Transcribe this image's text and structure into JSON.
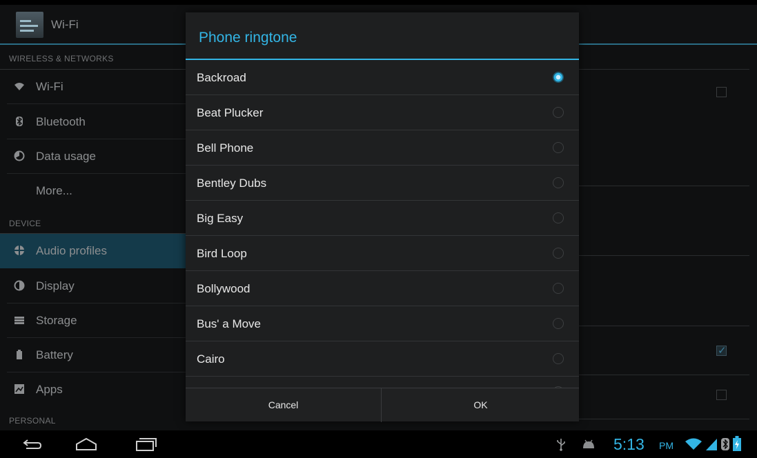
{
  "actionbar": {
    "title": "Wi-Fi"
  },
  "sidebar": {
    "sections": [
      {
        "header": "WIRELESS & NETWORKS"
      },
      {
        "header": "DEVICE"
      },
      {
        "header": "PERSONAL"
      }
    ],
    "items": [
      {
        "label": "Wi-Fi",
        "icon": "wifi-icon"
      },
      {
        "label": "Bluetooth",
        "icon": "bluetooth-icon"
      },
      {
        "label": "Data usage",
        "icon": "data-usage-icon"
      },
      {
        "label": "More...",
        "icon": ""
      },
      {
        "label": "Audio profiles",
        "icon": "audio-profiles-icon",
        "active": true
      },
      {
        "label": "Display",
        "icon": "display-icon"
      },
      {
        "label": "Storage",
        "icon": "storage-icon"
      },
      {
        "label": "Battery",
        "icon": "battery-icon"
      },
      {
        "label": "Apps",
        "icon": "apps-icon"
      }
    ]
  },
  "dialog": {
    "title": "Phone ringtone",
    "options": [
      {
        "label": "Backroad",
        "checked": true
      },
      {
        "label": "Beat Plucker",
        "checked": false
      },
      {
        "label": "Bell Phone",
        "checked": false
      },
      {
        "label": "Bentley Dubs",
        "checked": false
      },
      {
        "label": "Big Easy",
        "checked": false
      },
      {
        "label": "Bird Loop",
        "checked": false
      },
      {
        "label": "Bollywood",
        "checked": false
      },
      {
        "label": "Bus' a Move",
        "checked": false
      },
      {
        "label": "Cairo",
        "checked": false
      }
    ],
    "cancel_label": "Cancel",
    "ok_label": "OK"
  },
  "statusbar": {
    "time": "5:13",
    "ampm": "PM",
    "icons": [
      "usb-icon",
      "android-debug-icon",
      "wifi-signal-icon",
      "cell-signal-icon",
      "bluetooth-icon",
      "battery-charging-icon"
    ]
  },
  "navbar": {
    "buttons": [
      "back-button",
      "home-button",
      "recent-apps-button"
    ]
  },
  "colors": {
    "accent": "#33b5e5",
    "dialog_bg": "#1e1f20",
    "active_item_bg": "#143a4a"
  }
}
